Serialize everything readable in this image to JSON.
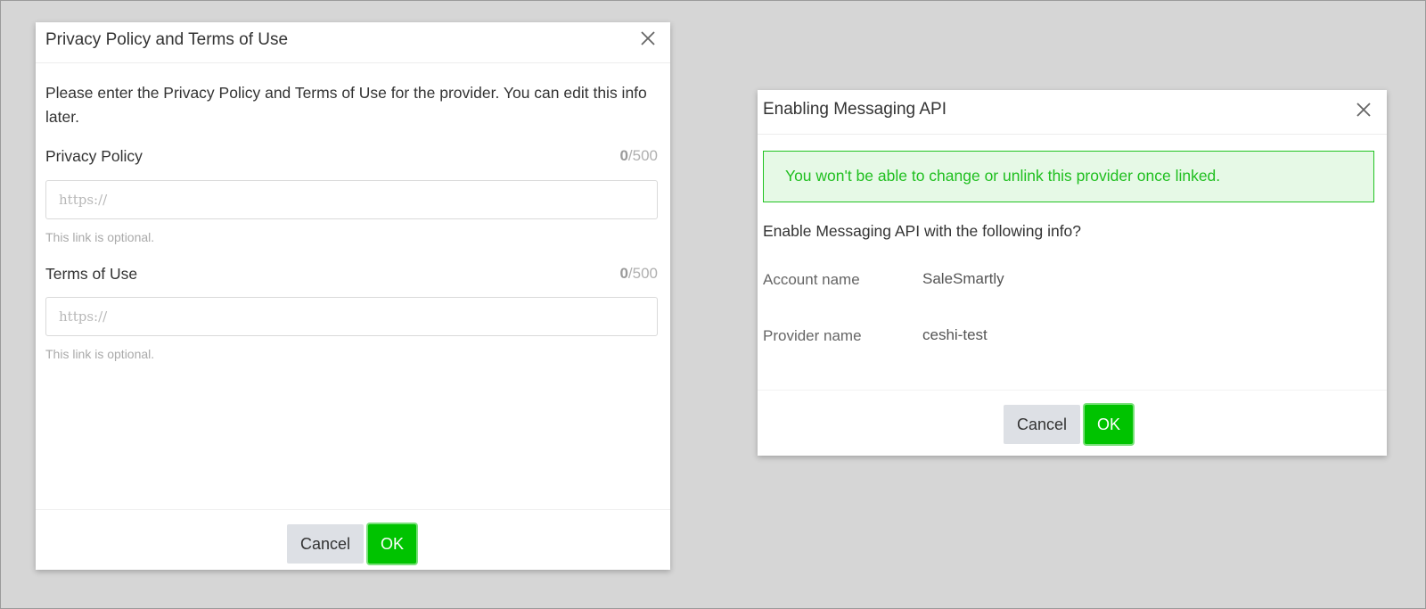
{
  "privacy_dialog": {
    "title": "Privacy Policy and Terms of Use",
    "close_icon": "close-icon",
    "description": "Please enter the Privacy Policy and Terms of Use for the provider. You can edit this info later.",
    "privacy_policy": {
      "label": "Privacy Policy",
      "count": "0",
      "max": "/500",
      "value": "",
      "placeholder": "https://",
      "hint": "This link is optional."
    },
    "terms_of_use": {
      "label": "Terms of Use",
      "count": "0",
      "max": "/500",
      "value": "",
      "placeholder": "https://",
      "hint": "This link is optional."
    },
    "cancel_label": "Cancel",
    "ok_label": "OK"
  },
  "messaging_dialog": {
    "title": "Enabling Messaging API",
    "close_icon": "close-icon",
    "notice": "You won't be able to change or unlink this provider once linked.",
    "question": "Enable Messaging API with the following info?",
    "info": [
      {
        "label": "Account name",
        "value": "SaleSmartly"
      },
      {
        "label": "Provider name",
        "value": "ceshi-test"
      }
    ],
    "cancel_label": "Cancel",
    "ok_label": "OK"
  },
  "colors": {
    "background": "#d6d6d6",
    "ok_green": "#00c300",
    "notice_bg": "#e6f9e6",
    "notice_text": "#1fbf1f",
    "cancel_bg": "#dde0e5"
  }
}
